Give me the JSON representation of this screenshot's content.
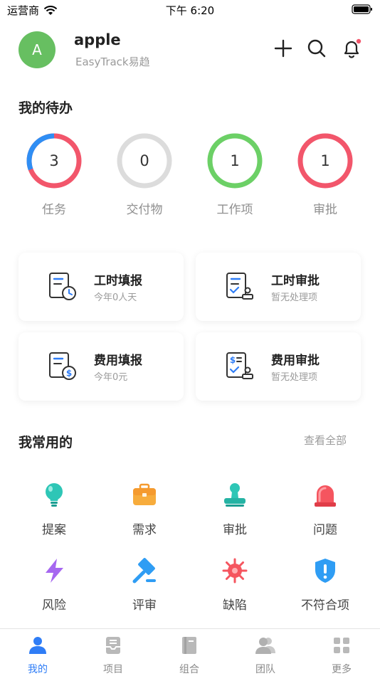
{
  "status_bar": {
    "carrier": "运营商",
    "time": "下午 6:20"
  },
  "user": {
    "avatar_letter": "A",
    "name": "apple",
    "subtitle": "EasyTrack易趋"
  },
  "todo": {
    "title": "我的待办",
    "items": [
      {
        "label": "任务",
        "count": "3"
      },
      {
        "label": "交付物",
        "count": "0"
      },
      {
        "label": "工作项",
        "count": "1"
      },
      {
        "label": "审批",
        "count": "1"
      }
    ]
  },
  "cards": [
    {
      "title": "工时填报",
      "subtitle": "今年0人天",
      "icon": "timesheet-clock-icon"
    },
    {
      "title": "工时审批",
      "subtitle": "暂无处理项",
      "icon": "timesheet-approve-icon"
    },
    {
      "title": "费用填报",
      "subtitle": "今年0元",
      "icon": "expense-dollar-icon"
    },
    {
      "title": "费用审批",
      "subtitle": "暂无处理项",
      "icon": "expense-approve-icon"
    }
  ],
  "favorites": {
    "title": "我常用的",
    "view_all": "查看全部",
    "items": [
      {
        "label": "提案",
        "icon": "lightbulb-icon"
      },
      {
        "label": "需求",
        "icon": "briefcase-icon"
      },
      {
        "label": "审批",
        "icon": "stamp-icon"
      },
      {
        "label": "问题",
        "icon": "alarm-light-icon"
      },
      {
        "label": "风险",
        "icon": "lightning-icon"
      },
      {
        "label": "评审",
        "icon": "gavel-icon"
      },
      {
        "label": "缺陷",
        "icon": "bug-icon"
      },
      {
        "label": "不符合项",
        "icon": "shield-alert-icon"
      }
    ]
  },
  "tabs": [
    {
      "label": "我的",
      "active": true
    },
    {
      "label": "项目",
      "active": false
    },
    {
      "label": "组合",
      "active": false
    },
    {
      "label": "团队",
      "active": false
    },
    {
      "label": "更多",
      "active": false
    }
  ],
  "colors": {
    "avatar": "#67bf61",
    "ring_red": "#f2566b",
    "ring_blue": "#2f8ef4",
    "ring_gray": "#dcdcdc",
    "ring_green": "#6cd066",
    "active_tab": "#2f7df6"
  }
}
